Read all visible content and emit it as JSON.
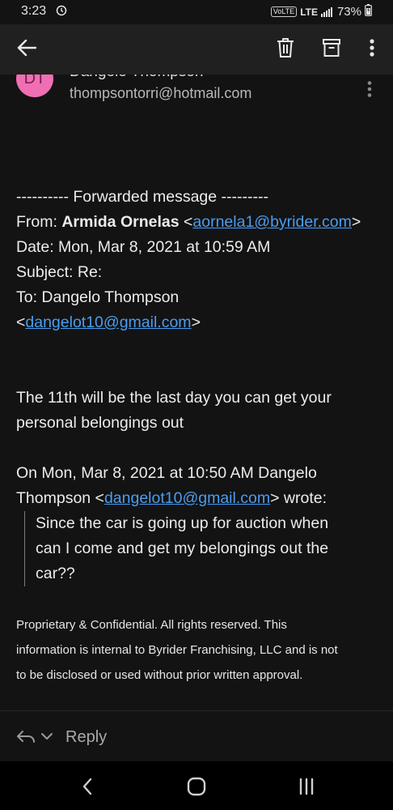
{
  "status": {
    "time": "3:23",
    "volte": "VoLTE",
    "network": "LTE",
    "battery": "73%"
  },
  "appbar": {
    "back_icon": "arrow-left-icon",
    "delete_icon": "trash-icon",
    "archive_icon": "archive-icon",
    "more_icon": "more-vert-icon"
  },
  "sender": {
    "initials": "DT",
    "name": "Dangelo Thompson",
    "email": "thompsontorri@hotmail.com"
  },
  "message": {
    "forward_header": "---------- Forwarded message ---------",
    "from_label": "From: ",
    "from_name": "Armida Ornelas",
    "from_email": "aornela1@byrider.com",
    "date": "Date: Mon, Mar 8, 2021 at 10:59 AM",
    "subject": "Subject: Re:",
    "to_label": "To: Dangelo Thompson",
    "to_email": "dangelot10@gmail.com",
    "body_line1": "The 11th will be the last day you can get your",
    "body_line2": "personal belongings out",
    "quote_header1": "On Mon, Mar 8, 2021 at 10:50 AM Dangelo",
    "quote_header2_prefix": "Thompson <",
    "quote_header_email": "dangelot10@gmail.com",
    "quote_header2_suffix": "> wrote:",
    "quote_line1": "Since the car is going up for auction when",
    "quote_line2": "can I come and get my belongings out the",
    "quote_line3": "car??"
  },
  "footer": {
    "line1": "Proprietary & Confidential. All rights reserved. This",
    "line2": "information is internal to Byrider Franchising, LLC and is not",
    "line3": "to be disclosed or used without prior written approval."
  },
  "reply": {
    "label": "Reply"
  },
  "colors": {
    "link": "#4a9df0",
    "avatar": "#f06fb4",
    "background": "#131313"
  }
}
